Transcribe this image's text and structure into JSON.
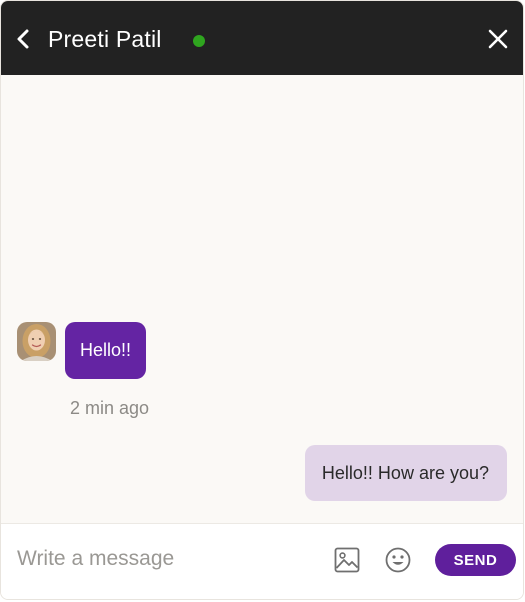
{
  "header": {
    "contact_name": "Preeti Patil",
    "status": "online",
    "back_icon": "chevron-left-icon",
    "close_icon": "close-icon"
  },
  "messages": [
    {
      "direction": "incoming",
      "text": "Hello!!",
      "time": "2 min ago"
    },
    {
      "direction": "outgoing",
      "text": "Hello!! How are you?"
    }
  ],
  "composer": {
    "placeholder": "Write a message",
    "value": "",
    "image_icon": "image-icon",
    "emoji_icon": "emoji-icon",
    "send_label": "SEND"
  },
  "colors": {
    "header_bg": "#222222",
    "online": "#2fa51f",
    "incoming_bubble": "#6424a3",
    "outgoing_bubble": "#e1d4e8",
    "send_button": "#5f1f9c",
    "chat_bg": "#fbf9f6"
  }
}
